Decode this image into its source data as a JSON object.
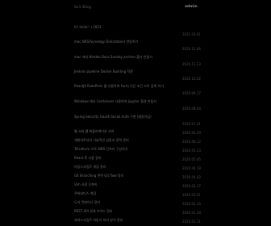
{
  "header": {
    "brand": "Sz1 Blog",
    "admin_label": "admin"
  },
  "posts": [
    {
      "title": "hi! hello! :) 2021",
      "date": "2021.03.01"
    },
    {
      "title": "mac NAS(Synology Diskstation) 연동하기",
      "date": "2020.12.06"
    },
    {
      "title": "mac 에서 Nimble Docs Sunday archive 폴더 만들기",
      "date": "2020.11.23"
    },
    {
      "title": "Jenkins pipeline Docker Building 적용",
      "date": "2020.10.02"
    },
    {
      "title": "ReactJS DatePickr 를 사용하여 Form 기간 조건 으로 검색 하기",
      "date": "2020.09.17"
    },
    {
      "title": "Windows 에서 Containers 사용하여 Jupyter 환경 만들기",
      "date": "2020.08.04"
    },
    {
      "title": "Spring Security Oauth Social Auth 구현 (회원가입)",
      "date": "2020.07.21"
    },
    {
      "title": "웹 서버 웹 애플리케이션 서버",
      "date": "2020.06.29"
    },
    {
      "title": "개발자로서의 기술적인 성장과 경력 관리",
      "date": "2020.06.12"
    },
    {
      "title": "Terraform 으로 AWS 인프라 구성하기",
      "date": "2020.05.23"
    },
    {
      "title": "React 훅 사용 정리",
      "date": "2020.05.05"
    },
    {
      "title": "타입스크립트 개념 정리",
      "date": "2020.04.19"
    },
    {
      "title": "Git Branching 전략 Git flow 정리",
      "date": "2020.04.02"
    },
    {
      "title": "Vim 사용 단축키",
      "date": "2020.03.17"
    },
    {
      "title": "쿠버네티스 개념",
      "date": "2020.03.01"
    },
    {
      "title": "도커 컨테이너 정리",
      "date": "2020.02.14"
    },
    {
      "title": "REST API 설계 가이드 정리",
      "date": "2020.01.28"
    },
    {
      "title": "자바스크립트 비동기 처리 방식 정리",
      "date": "2020.01.11"
    }
  ]
}
